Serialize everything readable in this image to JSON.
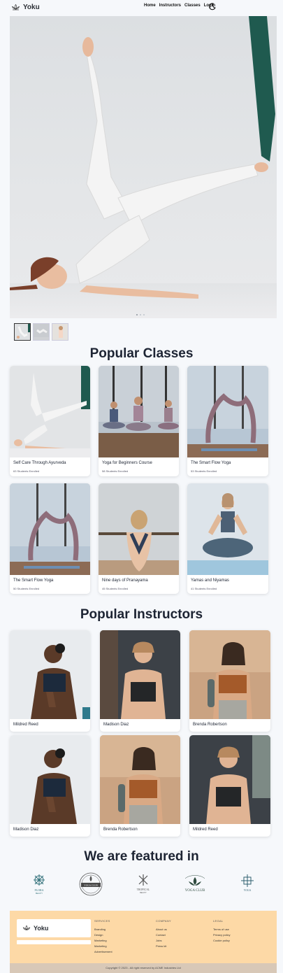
{
  "nav": {
    "brand": "Yoku",
    "links": [
      "Home",
      "Instructors",
      "Classes",
      "Login"
    ]
  },
  "hero": {
    "slides": 3,
    "active_slide": 1
  },
  "classes": {
    "heading": "Popular Classes",
    "items": [
      {
        "title": "Self Care Through Ayurveda",
        "students": "63 Students Enrolled"
      },
      {
        "title": "Yoga for Beginners Course",
        "students": "58 Students Enrolled"
      },
      {
        "title": "The Smart Flow Yoga",
        "students": "53 Students Enrolled"
      },
      {
        "title": "The Smart Flow Yoga",
        "students": "50 Students Enrolled"
      },
      {
        "title": "Nine days of Pranayama",
        "students": "45 Students Enrolled"
      },
      {
        "title": "Yamas and Niyamas",
        "students": "41 Students Enrolled"
      }
    ]
  },
  "instructors": {
    "heading": "Popular Instructors",
    "items": [
      "Mildred Reed",
      "Madison Diaz",
      "Brenda Robertson",
      "Madison Diaz",
      "Brenda Robertson",
      "Mildred Reed"
    ]
  },
  "featured": {
    "heading": "We are featured in",
    "logos": [
      {
        "name": "flora-logo",
        "text": "FLORA",
        "sub": "BEAUTY"
      },
      {
        "name": "yoga-club-logo",
        "text": "YOGA CLUB",
        "sub": ""
      },
      {
        "name": "tropical-logo",
        "text": "TROPICAL",
        "sub": "BEAUTY"
      },
      {
        "name": "yoga-club-lotus-logo",
        "text": "YOGA CLUB",
        "sub": ""
      },
      {
        "name": "yoga-logo",
        "text": "YOGA",
        "sub": ""
      }
    ]
  },
  "footer": {
    "brand": "Yoku",
    "columns": [
      {
        "head": "SERVICES",
        "items": [
          "Branding",
          "Design",
          "Marketing",
          "Marketing",
          "Advertisement"
        ]
      },
      {
        "head": "COMPANY",
        "items": [
          "About us",
          "Contact",
          "Jobs",
          "Press kit"
        ]
      },
      {
        "head": "LEGAL",
        "items": [
          "Terms of use",
          "Privacy policy",
          "Cookie policy"
        ]
      }
    ],
    "copyright": "Copyright © 2023 - All right reserved by ACME Industries Ltd"
  },
  "colors": {
    "footer_bg": "#fdd9a6",
    "copyright_bg": "#d8c8b7",
    "heading": "#1d2433"
  }
}
